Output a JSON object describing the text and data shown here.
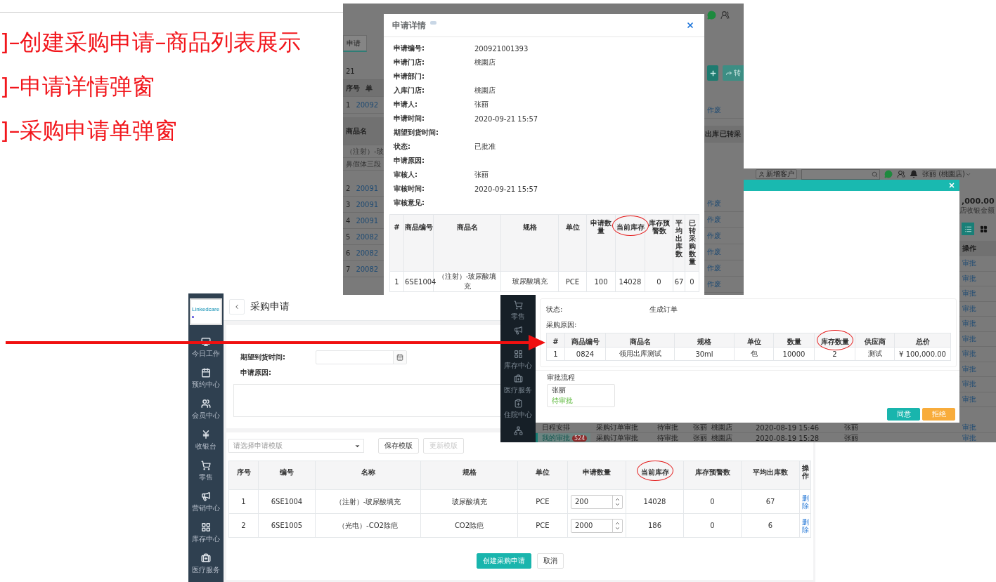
{
  "notes": [
    "]–创建采购申请–商品列表展示",
    "]–申请详情弹窗",
    "]–采购申请单弹窗"
  ],
  "detail_window": {
    "left_strip": {
      "tab": "申请",
      "value": "21",
      "columns": [
        "序号",
        "单"
      ],
      "first_row": [
        "1",
        "20092"
      ],
      "subtable": {
        "header": "商品名",
        "items": [
          "（注射）-玻",
          "鼻假体三段"
        ]
      },
      "rows": [
        [
          "2",
          "20091"
        ],
        [
          "3",
          "20091"
        ],
        [
          "4",
          "20091"
        ],
        [
          "5",
          "20082"
        ],
        [
          "6",
          "20082"
        ],
        [
          "7",
          "20082"
        ]
      ]
    },
    "right_strip": {
      "convert_button": "转",
      "columns": [
        "出库",
        "已转采"
      ],
      "first_link": "作废",
      "links": [
        "作废",
        "作废",
        "作废",
        "作废",
        "作废",
        "作废"
      ]
    },
    "modal": {
      "title": "申请详情",
      "fields": [
        {
          "label": "申请编号:",
          "value": "200921001393"
        },
        {
          "label": "申请门店:",
          "value": "桃園店"
        },
        {
          "label": "申请部门:"
        },
        {
          "label": "入库门店:",
          "value": "桃園店"
        },
        {
          "label": "申请人:",
          "value": "张丽"
        },
        {
          "label": "申请时间:",
          "value": "2020-09-21 15:57"
        },
        {
          "label": "期望到货时间:"
        },
        {
          "label": "状态:",
          "value": "已批准"
        },
        {
          "label": "申请原因:"
        },
        {
          "label": "审核人:",
          "value": "张丽"
        },
        {
          "label": "审核时间:",
          "value": "2020-09-21 15:57"
        },
        {
          "label": "审核意见:"
        }
      ],
      "table": {
        "columns": [
          {
            "label": "#",
            "circled": false
          },
          {
            "label": "商品编号",
            "circled": false
          },
          {
            "label": "商品名",
            "circled": false
          },
          {
            "label": "规格",
            "circled": false
          },
          {
            "label": "单位",
            "circled": false
          },
          {
            "label": "申请数量",
            "circled": false
          },
          {
            "label": "当前库存",
            "circled": true
          },
          {
            "label": "库存预警数",
            "circled": false
          },
          {
            "label": "平均出库数",
            "circled": false
          },
          {
            "label": "已转采购数量",
            "circled": false
          }
        ],
        "rows": [
          [
            "1",
            "6SE1004",
            "（注射）-玻尿酸填充",
            "玻尿酸填充",
            "PCE",
            "100",
            "14028",
            "0",
            "67",
            "0"
          ]
        ]
      }
    }
  },
  "order_window": {
    "topbar": {
      "new_customer": "新增客户",
      "user": "张丽 (桃園店)"
    },
    "sidebar": [
      "零售"
    ],
    "sidebar_lower": [
      "库存中心",
      "医疗服务",
      "住院中心"
    ],
    "summary": {
      "amount": ",000.00",
      "caption": "店收银金额"
    },
    "view_toggle": [
      {
        "selected": true
      },
      {
        "selected": false
      }
    ],
    "action_header": "操作",
    "links": [
      "审批",
      "审批",
      "审批",
      "审批",
      "审批",
      "审批",
      "审批",
      "审批",
      "审批",
      "审批"
    ],
    "nav": [
      {
        "label": "日程安排",
        "selected": false
      },
      {
        "label": "我的审批",
        "badge": "524",
        "selected": true
      }
    ],
    "rows": [
      {
        "cells": [
          "采购订单审批",
          "待审批",
          "张丽",
          "桃園店",
          "2020-08-19 15:46",
          "张丽"
        ],
        "link": "审批"
      },
      {
        "cells": [
          "采购订单审批",
          "待审批",
          "张丽",
          "桃園店",
          "2020-08-19 15:28",
          "张丽"
        ],
        "link": "审批"
      }
    ],
    "modal": {
      "fields": [
        {
          "label": "状态:",
          "value": "生成订单"
        },
        {
          "label": "采购原因:"
        }
      ],
      "table": {
        "columns": [
          {
            "label": "#",
            "circled": false
          },
          {
            "label": "商品编号",
            "circled": false
          },
          {
            "label": "商品名",
            "circled": false
          },
          {
            "label": "规格",
            "circled": false
          },
          {
            "label": "单位",
            "circled": false
          },
          {
            "label": "数量",
            "circled": false
          },
          {
            "label": "库存数量",
            "circled": true
          },
          {
            "label": "供应商",
            "circled": false
          },
          {
            "label": "总价",
            "circled": false
          }
        ],
        "rows": [
          [
            "1",
            "0824",
            "领用出库测试",
            "30ml",
            "包",
            "10000",
            "2",
            "测试",
            "¥ 100,000.00"
          ]
        ]
      },
      "flow_title": "审批流程",
      "approver": {
        "name": "张丽",
        "status": "待审批"
      },
      "buttons": [
        {
          "label": "同意",
          "kind": "primary"
        },
        {
          "label": "拒绝",
          "kind": "warning"
        }
      ]
    }
  },
  "request_page": {
    "logo": "Linkedcare",
    "sidebar": [
      "今日工作",
      "预约中心",
      "会员中心",
      "收银台",
      "零售",
      "营销中心",
      "库存中心",
      "医疗服务"
    ],
    "title": "采购申请",
    "form": {
      "expected_label": "期望到货时间:",
      "reason_label": "申请原因:"
    },
    "template": {
      "placeholder": "请选择申请模版",
      "save": "保存模版",
      "update": {
        "label": "更新模版",
        "disabled": true
      }
    },
    "table": {
      "columns": [
        {
          "label": "序号",
          "circled": false
        },
        {
          "label": "编号",
          "circled": false
        },
        {
          "label": "名称",
          "circled": false
        },
        {
          "label": "规格",
          "circled": false
        },
        {
          "label": "单位",
          "circled": false
        },
        {
          "label": "申请数量",
          "circled": false
        },
        {
          "label": "当前库存",
          "circled": true
        },
        {
          "label": "库存预警数",
          "circled": false
        },
        {
          "label": "平均出库数",
          "circled": false
        },
        {
          "label": "操作",
          "circled": false
        }
      ],
      "rows": [
        {
          "cells": [
            "1",
            "6SE1004",
            "（注射）-玻尿酸填充",
            "玻尿酸填充",
            "PCE"
          ],
          "quantity": "200",
          "stats": [
            "14028",
            "0",
            "67"
          ],
          "action": "删除"
        },
        {
          "cells": [
            "2",
            "6SE1005",
            "（光电）-CO2除疤",
            "CO2除疤",
            "PCE"
          ],
          "quantity": "2000",
          "stats": [
            "186",
            "0",
            "6"
          ],
          "action": "删除"
        }
      ]
    },
    "buttons": [
      {
        "label": "创建采购申请",
        "kind": "primary"
      },
      {
        "label": "取消",
        "kind": "default"
      }
    ]
  }
}
